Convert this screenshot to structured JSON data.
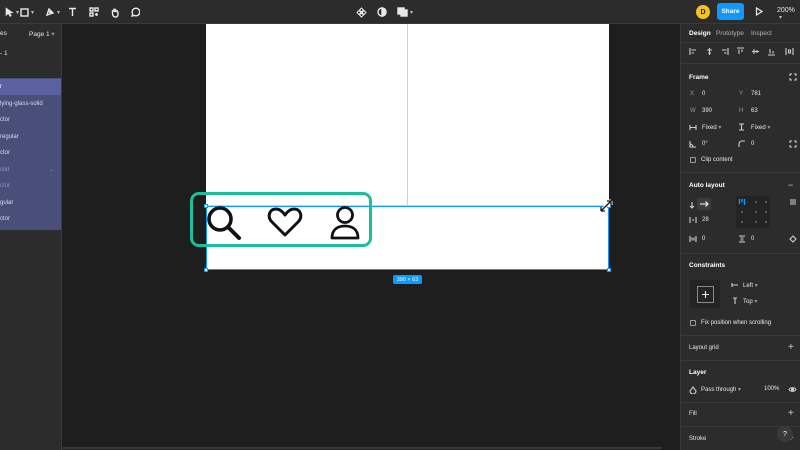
{
  "toolbar": {
    "tools": [
      "move-tool",
      "frame-tool",
      "pen-tool",
      "text-tool",
      "resource-tool",
      "hand-tool",
      "comment-tool"
    ],
    "avatar_initial": "D",
    "share_label": "Share",
    "zoom_label": "200%"
  },
  "left_panel": {
    "pages_label": "es",
    "page_label": "Page 1",
    "frame_label": "- 1",
    "layers": [
      {
        "label": "r",
        "state": "selected"
      },
      {
        "label": "lying-glass-solid",
        "state": "normal"
      },
      {
        "label": "ctor",
        "state": "normal"
      },
      {
        "label": "regular",
        "state": "normal"
      },
      {
        "label": "ctor",
        "state": "normal"
      },
      {
        "label": "olid",
        "state": "dim"
      },
      {
        "label": "ctor",
        "state": "dim"
      },
      {
        "label": "gular",
        "state": "normal"
      },
      {
        "label": "ctor",
        "state": "normal"
      }
    ]
  },
  "canvas": {
    "size_badge": "390 × 63",
    "icons": [
      "search-icon",
      "heart-icon",
      "user-icon"
    ],
    "highlight_color": "#1bbf9c",
    "selection_color": "#0d99ff"
  },
  "right_panel": {
    "tabs": [
      "Design",
      "Prototype",
      "Inspect"
    ],
    "active_tab": "Design",
    "frame": {
      "title": "Frame",
      "x_label": "X",
      "x": "0",
      "y_label": "Y",
      "y": "781",
      "w_label": "W",
      "w": "390",
      "h_label": "H",
      "h": "63",
      "horizontal_resizing": "Fixed",
      "vertical_resizing": "Fixed",
      "rotation": "0°",
      "corner_radius": "0",
      "clip_content": "Clip content"
    },
    "auto_layout": {
      "title": "Auto layout",
      "spacing": "28",
      "padding_horizontal": "0",
      "padding_vertical": "0"
    },
    "constraints": {
      "title": "Constraints",
      "horizontal": "Left",
      "vertical": "Top",
      "fix_position": "Fix position when scrolling"
    },
    "layout_grid": {
      "title": "Layout grid"
    },
    "layer": {
      "title": "Layer",
      "blend_mode": "Pass through",
      "opacity": "100%"
    },
    "fill": {
      "title": "Fill"
    },
    "stroke": {
      "title": "Stroke"
    },
    "help": "?"
  }
}
